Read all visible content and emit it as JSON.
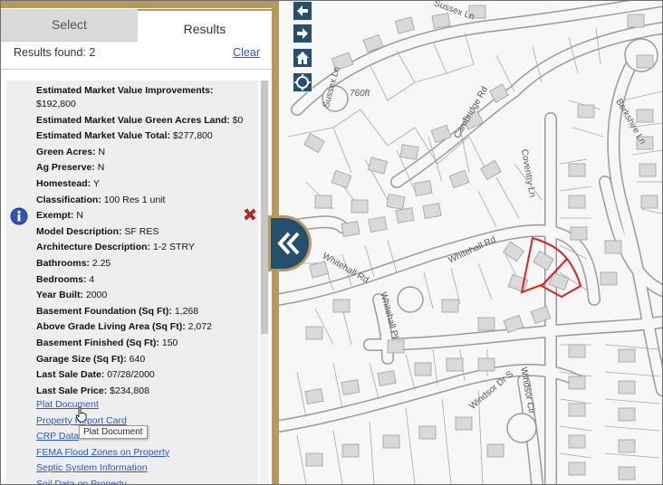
{
  "tabs": {
    "select": "Select",
    "results": "Results"
  },
  "results": {
    "found_label": "Results found: 2",
    "clear_label": "Clear"
  },
  "attributes": [
    {
      "label": "Estimated Market Value Improvements:",
      "value": ""
    },
    {
      "label": "",
      "value": "$192,800"
    },
    {
      "label": "Estimated Market Value Green Acres Land:",
      "value": " $0"
    },
    {
      "label": "Estimated Market Value Total:",
      "value": " $277,800"
    },
    {
      "label": "Green Acres:",
      "value": " N"
    },
    {
      "label": "Ag Preserve:",
      "value": " N"
    },
    {
      "label": "Homestead:",
      "value": " Y"
    },
    {
      "label": "Classification:",
      "value": " 100 Res 1 unit"
    },
    {
      "label": "Exempt:",
      "value": " N"
    },
    {
      "label": "Model Description:",
      "value": " SF RES"
    },
    {
      "label": "Architecture Description:",
      "value": " 1-2 STRY"
    },
    {
      "label": "Bathrooms:",
      "value": " 2.25"
    },
    {
      "label": "Bedrooms:",
      "value": " 4"
    },
    {
      "label": "Year Built:",
      "value": " 2000"
    },
    {
      "label": "Basement Foundation (Sq Ft):",
      "value": " 1,268"
    },
    {
      "label": "Above Grade Living Area (Sq Ft):",
      "value": " 2,072"
    },
    {
      "label": "Basement Finished (Sq Ft):",
      "value": " 150"
    },
    {
      "label": "Garage Size (Sq Ft):",
      "value": " 640"
    },
    {
      "label": "Last Sale Date:",
      "value": " 07/28/2000"
    },
    {
      "label": "Last Sale Price:",
      "value": " $234,808"
    }
  ],
  "links": [
    "Plat Document",
    "Property Report Card",
    "CRP Data",
    "FEMA Flood Zones on Property",
    "Septic System Information",
    "Soil Data on Property"
  ],
  "tooltip": "Plat Document",
  "icons": {
    "info": "info-icon",
    "delete": "delete-x-icon",
    "map_left": "arrow-left-icon",
    "map_right": "arrow-right-icon",
    "map_home": "home-icon",
    "map_locate": "locate-icon",
    "collapse": "double-chevron-left-icon"
  },
  "colors": {
    "panel_border": "#b7985d",
    "map_button": "#24506d",
    "link": "#2a57d4",
    "selected_parcel": "#e02020",
    "delete_icon": "#cc2222",
    "info_icon": "#2d56b8"
  },
  "map": {
    "streets": [
      "Sussex Ln",
      "Sussex Ln",
      "Cambridge Rd",
      "Coventry Ln",
      "Berkshire Ln",
      "Whitehall Rd",
      "Whitehall Rd",
      "Whitehall Pl",
      "Windsor Dr S",
      "Windsor Cir"
    ],
    "scale_label": "760ft"
  }
}
